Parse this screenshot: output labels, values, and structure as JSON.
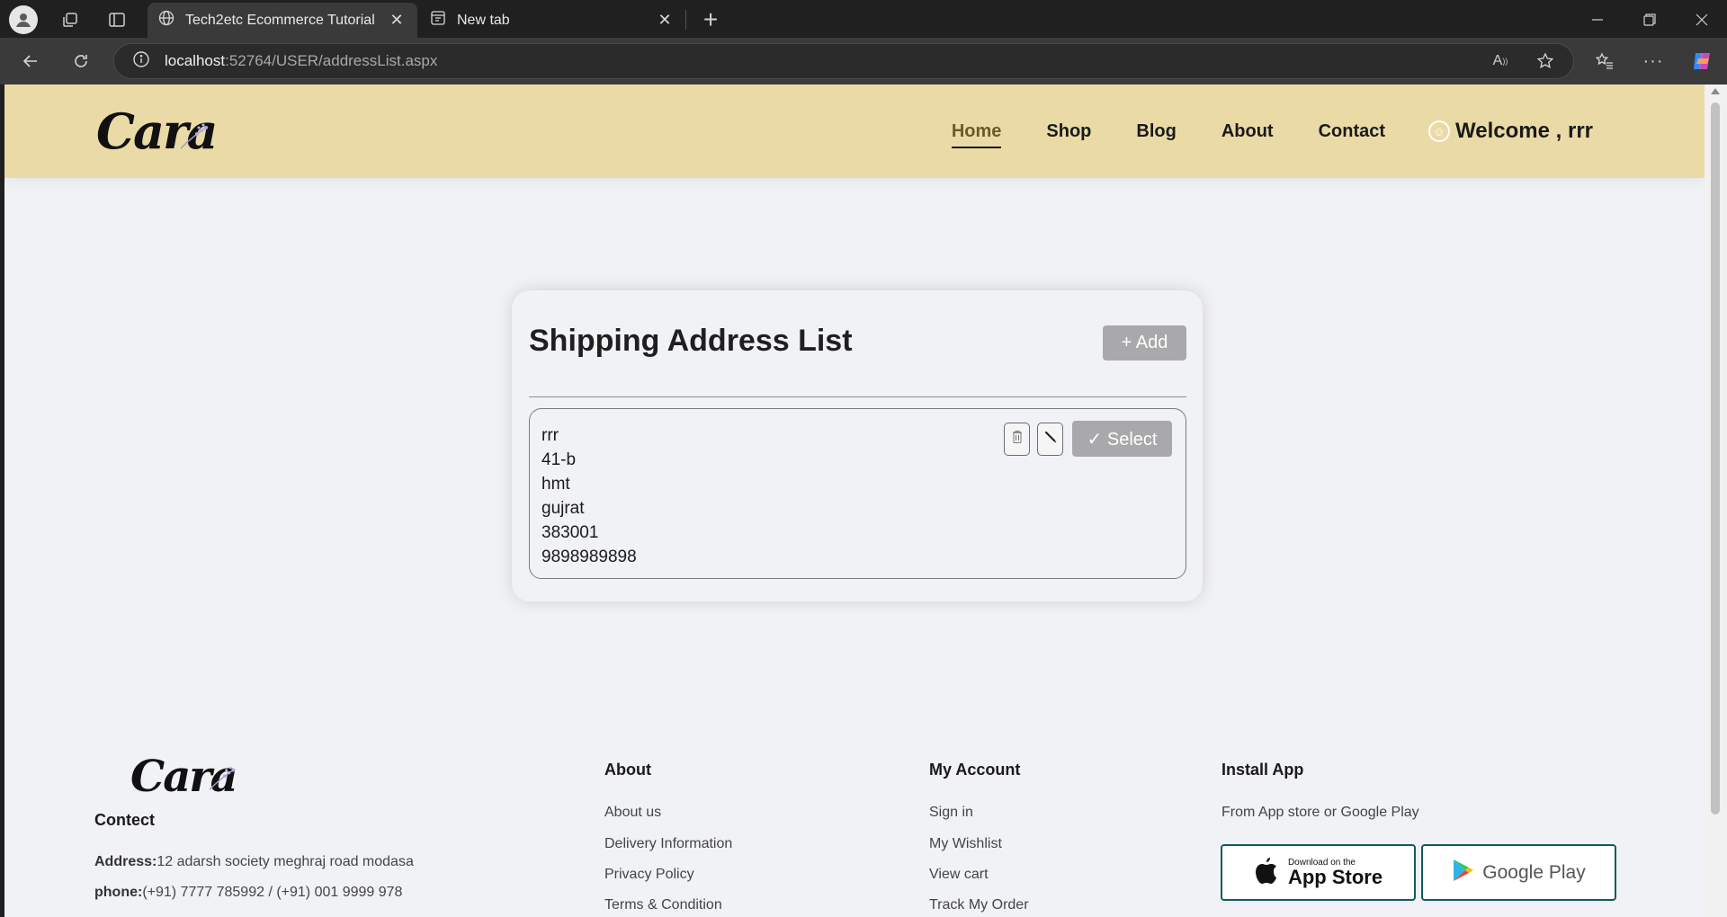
{
  "browser": {
    "tabs": [
      {
        "label": "Tech2etc Ecommerce Tutorial",
        "active": true
      },
      {
        "label": "New tab",
        "active": false
      }
    ],
    "url": {
      "host": "localhost",
      "path": ":52764/USER/addressList.aspx"
    }
  },
  "header": {
    "logo": "Cara",
    "nav": [
      "Home",
      "Shop",
      "Blog",
      "About",
      "Contact"
    ],
    "active_nav": "Home",
    "welcome": "Welcome , rrr"
  },
  "card": {
    "title": "Shipping Address List",
    "add_label": "+ Add",
    "address": [
      "rrr",
      "41-b",
      "hmt",
      "gujrat",
      "383001",
      "9898989898"
    ],
    "select_label": "✓ Select"
  },
  "footer": {
    "logo": "Cara",
    "contact": {
      "heading": "Contect",
      "address_label": "Address:",
      "address_value": "12 adarsh society meghraj road modasa",
      "phone_label": "phone:",
      "phone_value": "(+91) 7777 785992 / (+91) 001 9999 978"
    },
    "about": {
      "heading": "About",
      "links": [
        "About us",
        "Delivery Information",
        "Privacy Policy",
        "Terms & Condition"
      ]
    },
    "account": {
      "heading": "My Account",
      "links": [
        "Sign in",
        "My Wishlist",
        "View cart",
        "Track My Order"
      ]
    },
    "install": {
      "heading": "Install App",
      "text": "From App store or Google Play",
      "appstore_small": "Download on the",
      "appstore_big": "App Store",
      "googleplay": "Google Play"
    }
  },
  "colors": {
    "header_bg": "#eadba6",
    "page_bg": "#f1f2f6",
    "button_bg": "#a9a9ab",
    "store_border": "#0f5c5c"
  }
}
